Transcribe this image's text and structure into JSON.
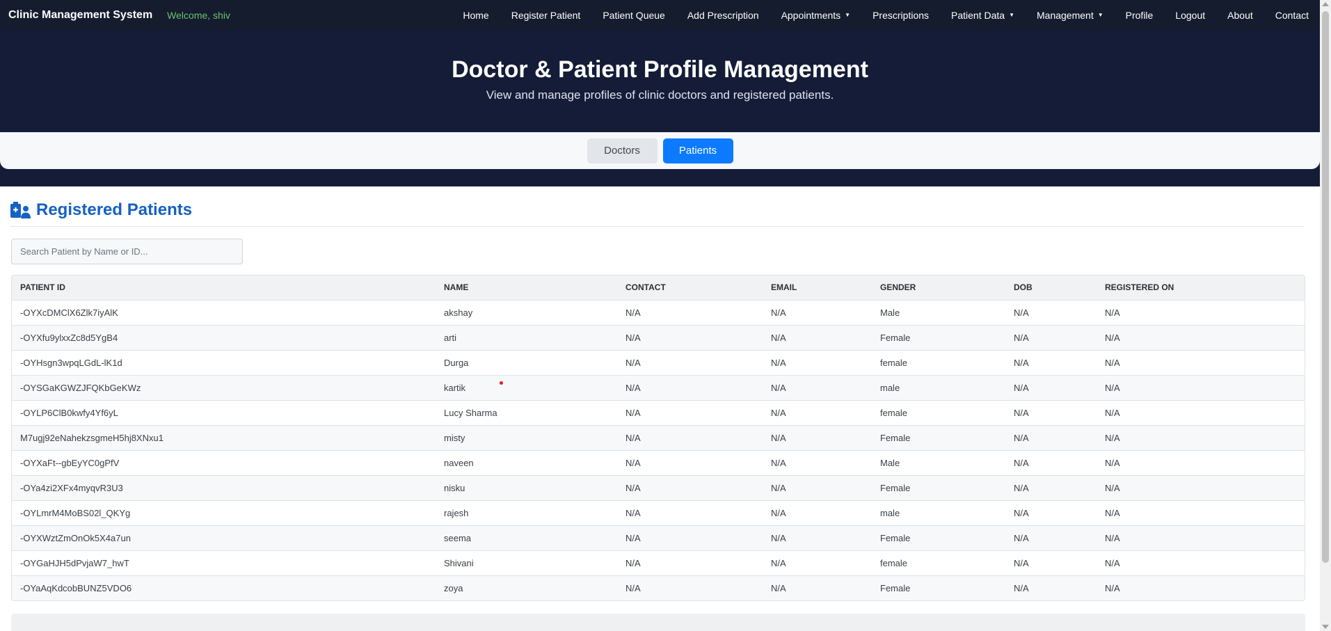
{
  "navbar": {
    "brand": "Clinic Management System",
    "welcome": "Welcome, shiv",
    "items": [
      {
        "label": "Home",
        "dropdown": false
      },
      {
        "label": "Register Patient",
        "dropdown": false
      },
      {
        "label": "Patient Queue",
        "dropdown": false
      },
      {
        "label": "Add Prescription",
        "dropdown": false
      },
      {
        "label": "Appointments",
        "dropdown": true
      },
      {
        "label": "Prescriptions",
        "dropdown": false
      },
      {
        "label": "Patient Data",
        "dropdown": true
      },
      {
        "label": "Management",
        "dropdown": true
      },
      {
        "label": "Profile",
        "dropdown": false
      },
      {
        "label": "Logout",
        "dropdown": false
      },
      {
        "label": "About",
        "dropdown": false
      },
      {
        "label": "Contact",
        "dropdown": false
      }
    ]
  },
  "hero": {
    "title": "Doctor & Patient Profile Management",
    "subtitle": "View and manage profiles of clinic doctors and registered patients."
  },
  "tabs": {
    "doctors_label": "Doctors",
    "patients_label": "Patients",
    "active": "Patients"
  },
  "section": {
    "title": "Registered Patients",
    "icon": "patient-profile-icon"
  },
  "search": {
    "placeholder": "Search Patient by Name or ID...",
    "value": ""
  },
  "table": {
    "columns": [
      "PATIENT ID",
      "NAME",
      "CONTACT",
      "EMAIL",
      "GENDER",
      "DOB",
      "REGISTERED ON"
    ],
    "rows": [
      [
        "-OYXcDMClX6Zlk7iyAlK",
        "akshay",
        "N/A",
        "N/A",
        "Male",
        "N/A",
        "N/A"
      ],
      [
        "-OYXfu9ylxxZc8d5YgB4",
        "arti",
        "N/A",
        "N/A",
        "Female",
        "N/A",
        "N/A"
      ],
      [
        "-OYHsgn3wpqLGdL-lK1d",
        "Durga",
        "N/A",
        "N/A",
        "female",
        "N/A",
        "N/A"
      ],
      [
        "-OYSGaKGWZJFQKbGeKWz",
        "kartik",
        "N/A",
        "N/A",
        "male",
        "N/A",
        "N/A"
      ],
      [
        "-OYLP6ClB0kwfy4Yf6yL",
        "Lucy Sharma",
        "N/A",
        "N/A",
        "female",
        "N/A",
        "N/A"
      ],
      [
        "M7ugj92eNahekzsgmeH5hj8XNxu1",
        "misty",
        "N/A",
        "N/A",
        "Female",
        "N/A",
        "N/A"
      ],
      [
        "-OYXaFt--gbEyYC0gPfV",
        "naveen",
        "N/A",
        "N/A",
        "Male",
        "N/A",
        "N/A"
      ],
      [
        "-OYa4zi2XFx4myqvR3U3",
        "nisku",
        "N/A",
        "N/A",
        "Female",
        "N/A",
        "N/A"
      ],
      [
        "-OYLmrM4MoBS02l_QKYg",
        "rajesh",
        "N/A",
        "N/A",
        "male",
        "N/A",
        "N/A"
      ],
      [
        "-OYXWztZmOnOk5X4a7un",
        "seema",
        "N/A",
        "N/A",
        "Female",
        "N/A",
        "N/A"
      ],
      [
        "-OYGaHJH5dPvjaW7_hwT",
        "Shivani",
        "N/A",
        "N/A",
        "female",
        "N/A",
        "N/A"
      ],
      [
        "-OYaAqKdcobBUNZ5VDO6",
        "zoya",
        "N/A",
        "N/A",
        "Female",
        "N/A",
        "N/A"
      ]
    ]
  },
  "colors": {
    "navbar_bg": "#141c2e",
    "hero_bg": "#141c38",
    "accent": "#0d7bff",
    "section_title": "#1561c4",
    "welcome_text": "#6cc36e"
  }
}
